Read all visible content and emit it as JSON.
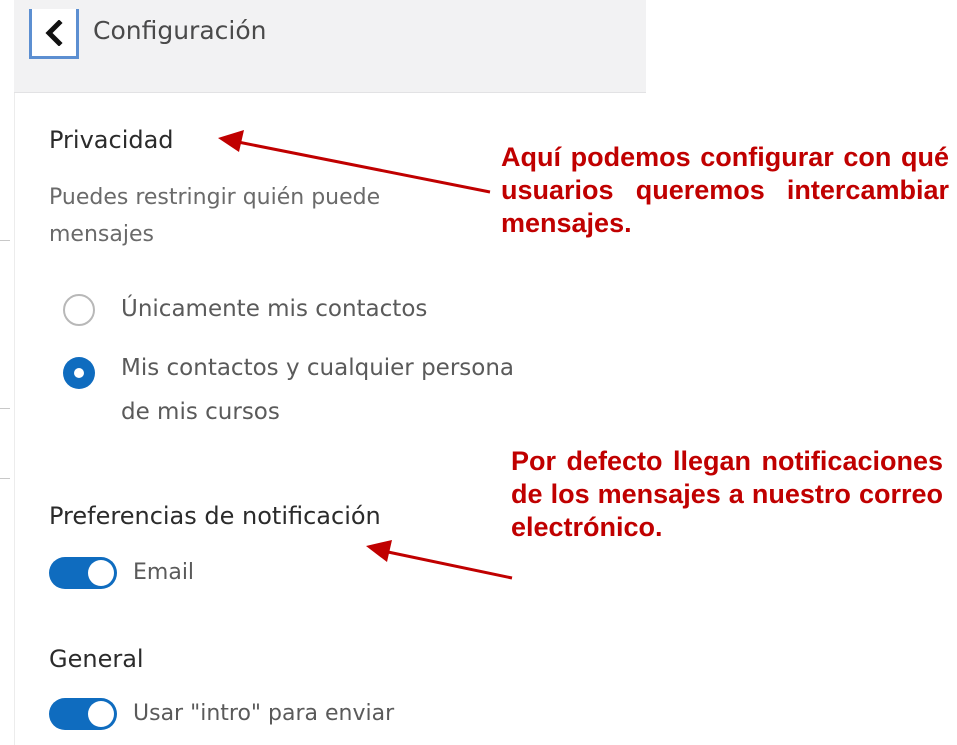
{
  "header": {
    "title": "Configuración"
  },
  "privacy": {
    "heading": "Privacidad",
    "description_line1": "Puedes restringir quién puede",
    "description_line2": "mensajes",
    "options": [
      {
        "label": "Únicamente mis contactos",
        "selected": false
      },
      {
        "label_line1": "Mis contactos y cualquier persona",
        "label_line2": "de mis cursos",
        "selected": true
      }
    ]
  },
  "notifications": {
    "heading": "Preferencias de notificación",
    "email_label": "Email",
    "email_enabled": true
  },
  "general": {
    "heading": "General",
    "enter_to_send_label": "Usar \"intro\" para enviar",
    "enter_to_send_enabled": true
  },
  "annotations": {
    "privacy_note": "Aquí podemos configurar con qué usuarios queremos intercambiar mensajes.",
    "notifications_note": "Por defecto llegan notificaciones de los mensajes a nuestro correo electrónico."
  },
  "colors": {
    "accent": "#0f6cbf",
    "annotation": "#c00000",
    "back_button_border": "#5c8fd1"
  }
}
